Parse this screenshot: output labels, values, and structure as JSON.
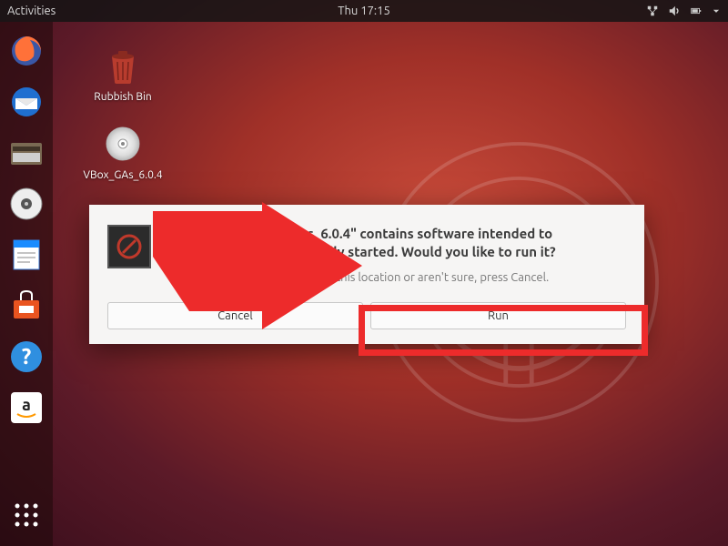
{
  "topbar": {
    "activities": "Activities",
    "clock": "Thu 17:15",
    "icons": [
      "network-icon",
      "volume-icon",
      "battery-icon",
      "dropdown-icon"
    ]
  },
  "launcher": {
    "items": [
      {
        "name": "firefox",
        "color": "#ff7139"
      },
      {
        "name": "thunderbird",
        "color": "#1f6fd0"
      },
      {
        "name": "files",
        "color": "#d9c28f"
      },
      {
        "name": "rhythmbox",
        "color": "#eeeeee"
      },
      {
        "name": "libreoffice-writer",
        "color": "#1a8cff"
      },
      {
        "name": "software",
        "color": "#e95420"
      },
      {
        "name": "help",
        "color": "#2f8fe0"
      },
      {
        "name": "amazon",
        "color": "#ffffff"
      }
    ],
    "show_apps": "Show Applications"
  },
  "desktop_icons": [
    {
      "label": "Rubbish Bin",
      "kind": "trash"
    },
    {
      "label": "VBox_GAs_6.0.4",
      "kind": "disc"
    }
  ],
  "dialog": {
    "title_line1": "\"VBox_GAs_6.0.4\" contains software intended to",
    "title_line2": "be automatically started. Would you like to run it?",
    "subtext": "If you don't trust this location or aren't sure, press Cancel.",
    "cancel": "Cancel",
    "run": "Run"
  },
  "annotation": {
    "highlight_target": "run-button"
  }
}
